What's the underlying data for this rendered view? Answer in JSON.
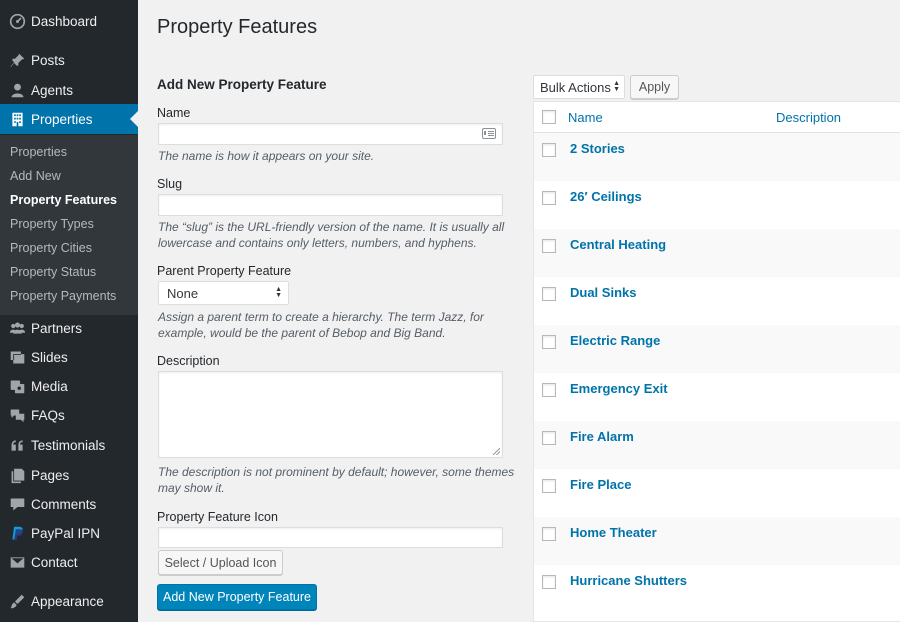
{
  "sidebar": {
    "items": [
      {
        "label": "Dashboard",
        "icon": "dashboard-icon"
      },
      {
        "label": "Posts",
        "icon": "pin-icon"
      },
      {
        "label": "Agents",
        "icon": "user-icon"
      },
      {
        "label": "Properties",
        "icon": "building-icon",
        "active": true
      },
      {
        "label": "Partners",
        "icon": "groups-icon"
      },
      {
        "label": "Slides",
        "icon": "slides-icon"
      },
      {
        "label": "Media",
        "icon": "media-icon"
      },
      {
        "label": "FAQs",
        "icon": "faq-icon"
      },
      {
        "label": "Testimonials",
        "icon": "quote-icon"
      },
      {
        "label": "Pages",
        "icon": "pages-icon"
      },
      {
        "label": "Comments",
        "icon": "comment-icon"
      },
      {
        "label": "PayPal IPN",
        "icon": "paypal-icon"
      },
      {
        "label": "Contact",
        "icon": "mail-icon"
      },
      {
        "label": "Appearance",
        "icon": "brush-icon"
      }
    ],
    "submenu": [
      {
        "label": "Properties"
      },
      {
        "label": "Add New"
      },
      {
        "label": "Property Features",
        "current": true
      },
      {
        "label": "Property Types"
      },
      {
        "label": "Property Cities"
      },
      {
        "label": "Property Status"
      },
      {
        "label": "Property Payments"
      }
    ]
  },
  "page": {
    "title": "Property Features"
  },
  "form": {
    "heading": "Add New Property Feature",
    "name_label": "Name",
    "name_value": "",
    "name_hint": "The name is how it appears on your site.",
    "slug_label": "Slug",
    "slug_value": "",
    "slug_hint": "The “slug” is the URL-friendly version of the name. It is usually all lowercase and contains only letters, numbers, and hyphens.",
    "parent_label": "Parent Property Feature",
    "parent_value": "None",
    "parent_hint": "Assign a parent term to create a hierarchy. The term Jazz, for example, would be the parent of Bebop and Big Band.",
    "description_label": "Description",
    "description_value": "",
    "description_hint": "The description is not prominent by default; however, some themes may show it.",
    "icon_label": "Property Feature Icon",
    "icon_value": "",
    "upload_button": "Select / Upload Icon",
    "submit_button": "Add New Property Feature"
  },
  "bulk": {
    "selected": "Bulk Actions",
    "apply_label": "Apply"
  },
  "table": {
    "columns": [
      "Name",
      "Description"
    ],
    "rows": [
      "2 Stories",
      "26′ Ceilings",
      "Central Heating",
      "Dual Sinks",
      "Electric Range",
      "Emergency Exit",
      "Fire Alarm",
      "Fire Place",
      "Home Theater",
      "Hurricane Shutters"
    ]
  },
  "colors": {
    "sidebar_bg": "#23282d",
    "submenu_bg": "#32373c",
    "accent": "#0073aa",
    "primary_button": "#0085ba"
  }
}
